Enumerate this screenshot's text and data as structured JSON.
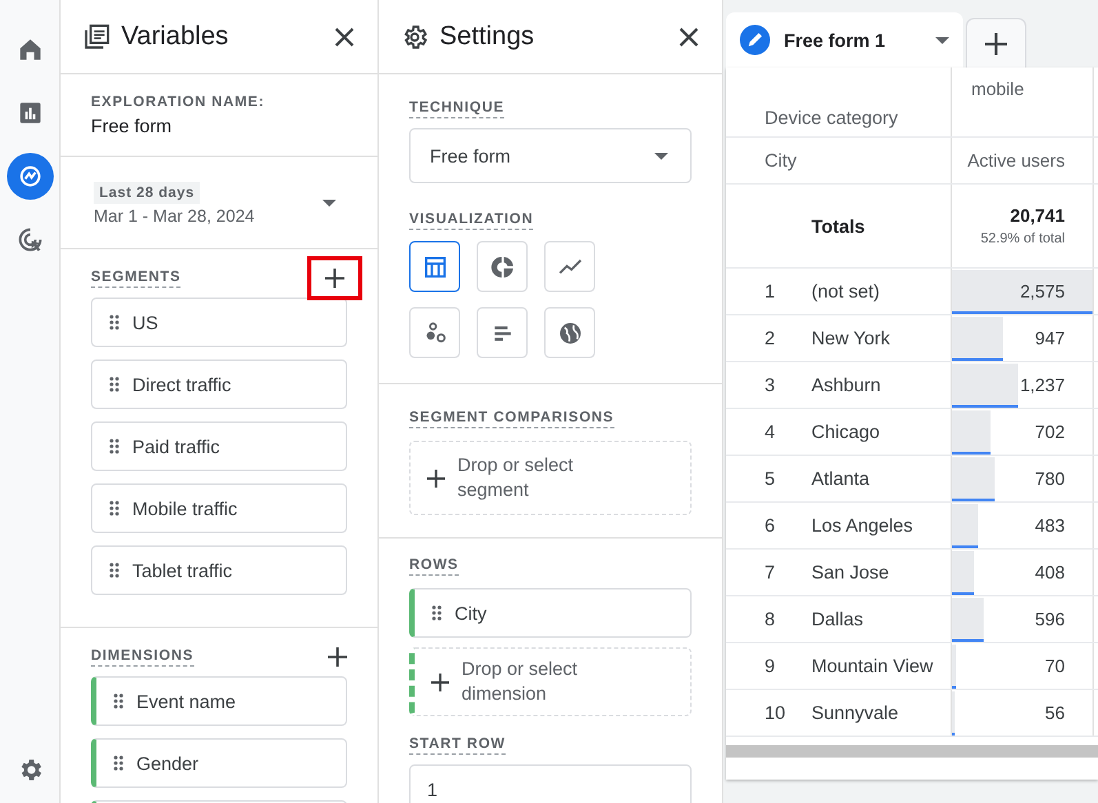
{
  "nav": {
    "items": [
      {
        "kind": "home",
        "selected": false
      },
      {
        "kind": "reports",
        "selected": false
      },
      {
        "kind": "explore",
        "selected": true
      },
      {
        "kind": "advertising",
        "selected": false
      }
    ]
  },
  "variables": {
    "title": "Variables",
    "exploration_label": "EXPLORATION NAME:",
    "exploration_name": "Free form",
    "date_badge": "Last 28 days",
    "date_range": "Mar 1 - Mar 28, 2024",
    "segments": {
      "label": "SEGMENTS",
      "add_highlighted": true,
      "items": [
        "US",
        "Direct traffic",
        "Paid traffic",
        "Mobile traffic",
        "Tablet traffic"
      ]
    },
    "dimensions": {
      "label": "DIMENSIONS",
      "items": [
        "Event name",
        "Gender"
      ]
    }
  },
  "settings": {
    "title": "Settings",
    "technique_label": "TECHNIQUE",
    "technique": "Free form",
    "visualization_label": "VISUALIZATION",
    "visualizations": [
      {
        "kind": "table",
        "selected": true
      },
      {
        "kind": "donut",
        "selected": false
      },
      {
        "kind": "line",
        "selected": false
      },
      {
        "kind": "scatter",
        "selected": false
      },
      {
        "kind": "bar",
        "selected": false
      },
      {
        "kind": "geo",
        "selected": false
      }
    ],
    "segment_comparisons_label": "SEGMENT COMPARISONS",
    "segment_drop": "Drop or select segment",
    "rows_label": "ROWS",
    "rows": [
      "City"
    ],
    "dimension_drop": "Drop or select dimension",
    "start_row_label": "START ROW",
    "start_row": "1"
  },
  "tab": {
    "title": "Free form 1"
  },
  "table": {
    "pivot_label": "Device category",
    "pivot_value": "mobile",
    "row_label": "City",
    "metric": "Active users",
    "totals_label": "Totals",
    "total": "20,741",
    "total_share": "52.9% of total",
    "rows": [
      {
        "index": "1",
        "city": "(not set)",
        "value": "2,575",
        "level": 1
      },
      {
        "index": "2",
        "city": "New York",
        "value": "947",
        "level": 0.36
      },
      {
        "index": "3",
        "city": "Ashburn",
        "value": "1,237",
        "level": 0.47
      },
      {
        "index": "4",
        "city": "Chicago",
        "value": "702",
        "level": 0.27
      },
      {
        "index": "5",
        "city": "Atlanta",
        "value": "780",
        "level": 0.3
      },
      {
        "index": "6",
        "city": "Los Angeles",
        "value": "483",
        "level": 0.19
      },
      {
        "index": "7",
        "city": "San Jose",
        "value": "408",
        "level": 0.16
      },
      {
        "index": "8",
        "city": "Dallas",
        "value": "596",
        "level": 0.23
      },
      {
        "index": "9",
        "city": "Mountain View",
        "value": "70",
        "level": 0.03
      },
      {
        "index": "10",
        "city": "Sunnyvale",
        "value": "56",
        "level": 0.02
      }
    ]
  }
}
